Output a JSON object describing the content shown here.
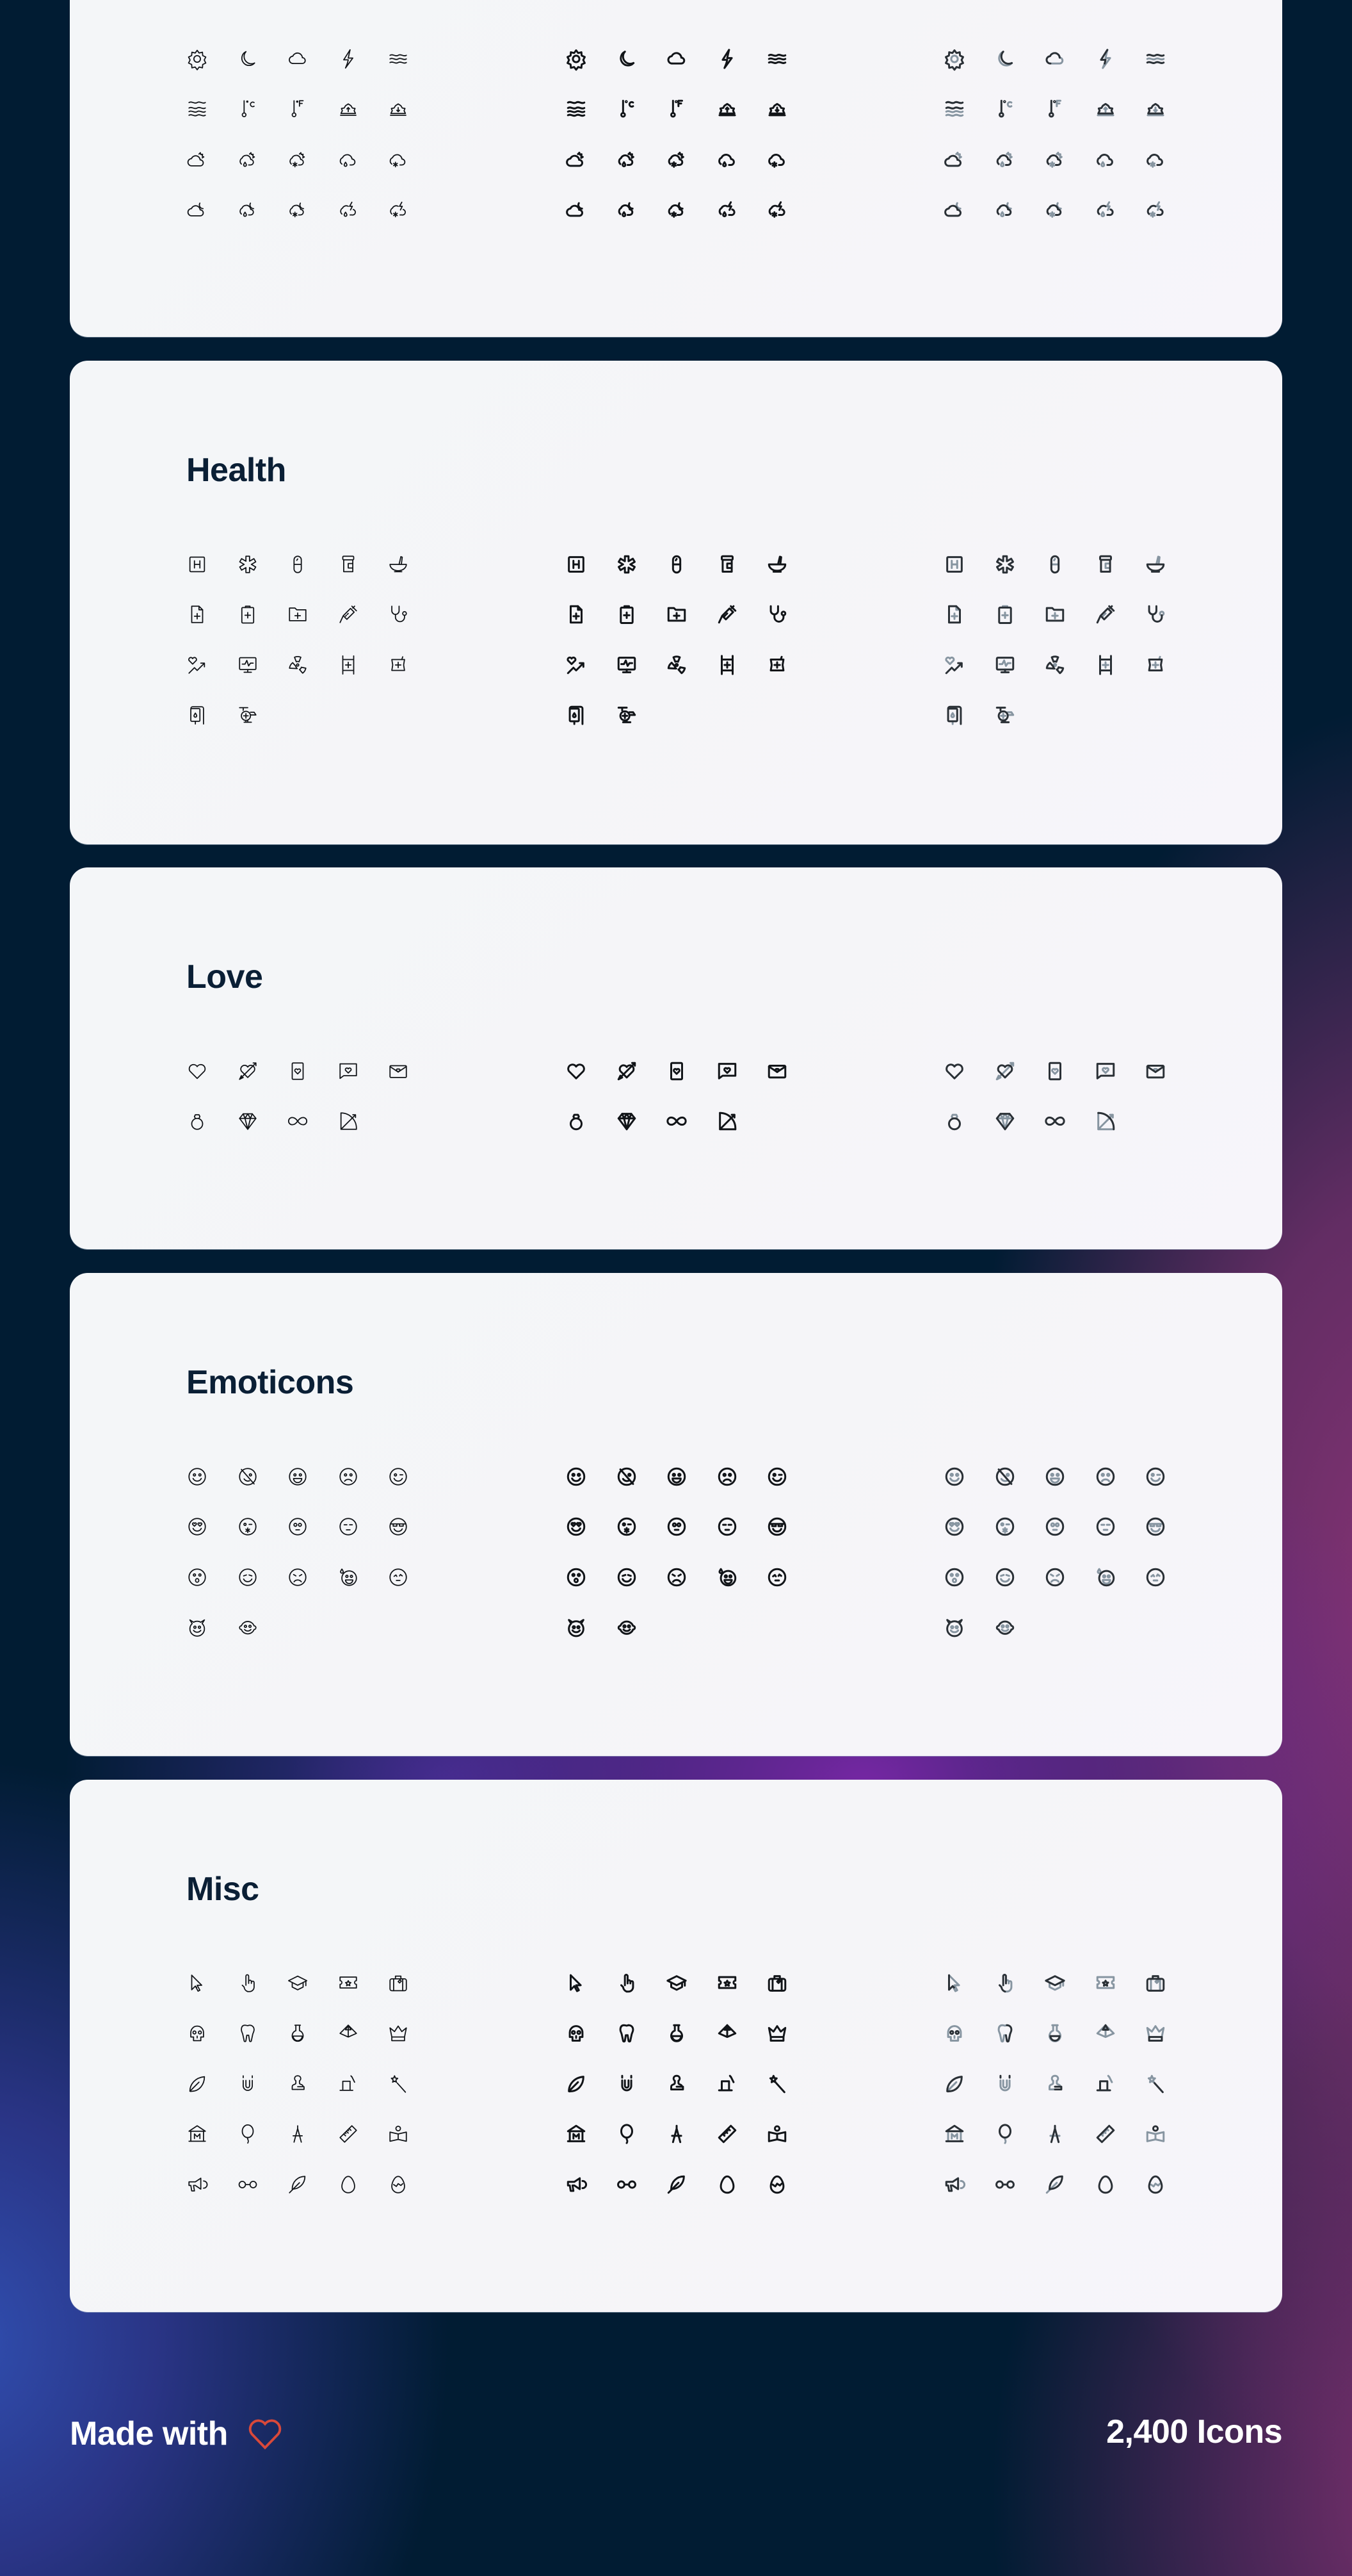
{
  "colors": {
    "page_bg": "#011c33",
    "card_bg": "#f5f6f8",
    "title": "#0a1f35",
    "line_icon": "#111418",
    "duo_dark": "#2a3036",
    "duo_light": "#8795a1",
    "footer_text": "#ffffff",
    "heart": "#d9493a"
  },
  "styles": [
    "line",
    "bold",
    "duotone"
  ],
  "sections": [
    {
      "title": "",
      "icons": [
        [
          "sun-icon",
          "moon-icon",
          "cloud-icon",
          "lightning-icon",
          "wind-icon"
        ],
        [
          "waves-icon",
          "thermometer-celsius-icon",
          "thermometer-fahrenheit-icon",
          "sunrise-icon",
          "sunset-icon"
        ],
        [
          "cloud-sun-icon",
          "cloud-sun-rain-icon",
          "cloud-sun-snow-icon",
          "cloud-rain-icon",
          "cloud-snow-icon"
        ],
        [
          "cloud-moon-icon",
          "cloud-moon-rain-icon",
          "cloud-moon-snow-icon",
          "cloud-lightning-rain-icon",
          "cloud-lightning-snow-icon"
        ]
      ]
    },
    {
      "title": "Health",
      "icons": [
        [
          "hospital-sign-icon",
          "medical-star-icon",
          "pill-capsule-icon",
          "pill-bottle-icon",
          "mortar-pestle-icon"
        ],
        [
          "medical-file-icon",
          "medical-clipboard-icon",
          "medical-folder-icon",
          "syringe-icon",
          "stethoscope-icon"
        ],
        [
          "heart-rate-up-icon",
          "heart-monitor-icon",
          "radiation-icon",
          "stretcher-icon",
          "medicine-pouch-icon"
        ],
        [
          "blood-bag-icon",
          "medical-helicopter-icon"
        ]
      ]
    },
    {
      "title": "Love",
      "icons": [
        [
          "heart-icon",
          "heart-arrow-icon",
          "love-card-icon",
          "love-message-icon",
          "love-letter-icon"
        ],
        [
          "ring-icon",
          "diamond-icon",
          "infinity-icon",
          "bow-arrow-icon"
        ]
      ]
    },
    {
      "title": "Emoticons",
      "icons": [
        [
          "smile-icon",
          "smile-off-icon",
          "grin-icon",
          "sad-icon",
          "wink-icon"
        ],
        [
          "heart-eyes-icon",
          "kiss-icon",
          "shocked-blank-icon",
          "expressionless-icon",
          "nerd-icon"
        ],
        [
          "surprised-icon",
          "content-icon",
          "angry-icon",
          "sweat-smile-icon",
          "worried-icon"
        ],
        [
          "devil-icon",
          "baby-icon"
        ]
      ]
    },
    {
      "title": "Misc",
      "icons": [
        [
          "cursor-arrow-icon",
          "hand-pointer-icon",
          "graduation-cap-icon",
          "ticket-icon",
          "luggage-icon"
        ],
        [
          "skull-icon",
          "tooth-icon",
          "flask-icon",
          "pyramid-icon",
          "crown-icon"
        ],
        [
          "leaf-icon",
          "magnet-icon",
          "stamp-icon",
          "magic-hat-icon",
          "magic-wand-icon"
        ],
        [
          "museum-icon",
          "balloon-icon",
          "compass-drawing-icon",
          "ruler-icon",
          "reader-book-icon"
        ],
        [
          "megaphone-icon",
          "glasses-icon",
          "feather-icon",
          "egg-icon",
          "egg-cracked-icon"
        ]
      ]
    }
  ],
  "footer": {
    "made_with": "Made with",
    "heart_icon": "heart-icon",
    "count_label": "2,400 Icons"
  }
}
